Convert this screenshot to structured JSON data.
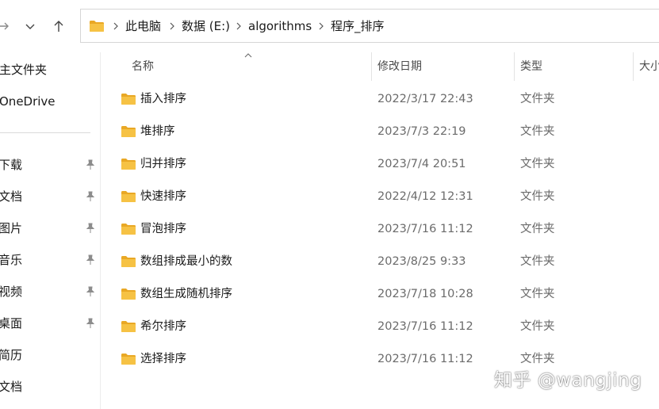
{
  "address": {
    "crumbs": [
      "此电脑",
      "数据 (E:)",
      "algorithms",
      "程序_排序"
    ]
  },
  "sidebar": {
    "items": [
      {
        "label": "主文件夹",
        "pinned": false
      },
      {
        "label": "OneDrive",
        "pinned": false
      },
      {
        "label": "下载",
        "pinned": true
      },
      {
        "label": "文档",
        "pinned": true
      },
      {
        "label": "图片",
        "pinned": true
      },
      {
        "label": "音乐",
        "pinned": true
      },
      {
        "label": "视频",
        "pinned": true
      },
      {
        "label": "桌面",
        "pinned": true
      },
      {
        "label": "简历",
        "pinned": false
      },
      {
        "label": "文档",
        "pinned": false
      }
    ]
  },
  "columns": {
    "name": "名称",
    "date": "修改日期",
    "type": "类型",
    "size": "大小"
  },
  "files": [
    {
      "name": "插入排序",
      "date": "2022/3/17 22:43",
      "type": "文件夹"
    },
    {
      "name": "堆排序",
      "date": "2023/7/3 22:19",
      "type": "文件夹"
    },
    {
      "name": "归并排序",
      "date": "2023/7/4 20:51",
      "type": "文件夹"
    },
    {
      "name": "快速排序",
      "date": "2022/4/12 12:31",
      "type": "文件夹"
    },
    {
      "name": "冒泡排序",
      "date": "2023/7/16 11:12",
      "type": "文件夹"
    },
    {
      "name": "数组排成最小的数",
      "date": "2023/8/25 9:33",
      "type": "文件夹"
    },
    {
      "name": "数组生成随机排序",
      "date": "2023/7/18 10:28",
      "type": "文件夹"
    },
    {
      "name": "希尔排序",
      "date": "2023/7/16 11:12",
      "type": "文件夹"
    },
    {
      "name": "选择排序",
      "date": "2023/7/16 11:12",
      "type": "文件夹"
    }
  ],
  "watermark": "知乎 @wangjing",
  "colors": {
    "folder": "#f6c244",
    "folder_dark": "#e9a825",
    "secondary_text": "#6b6b6b"
  }
}
